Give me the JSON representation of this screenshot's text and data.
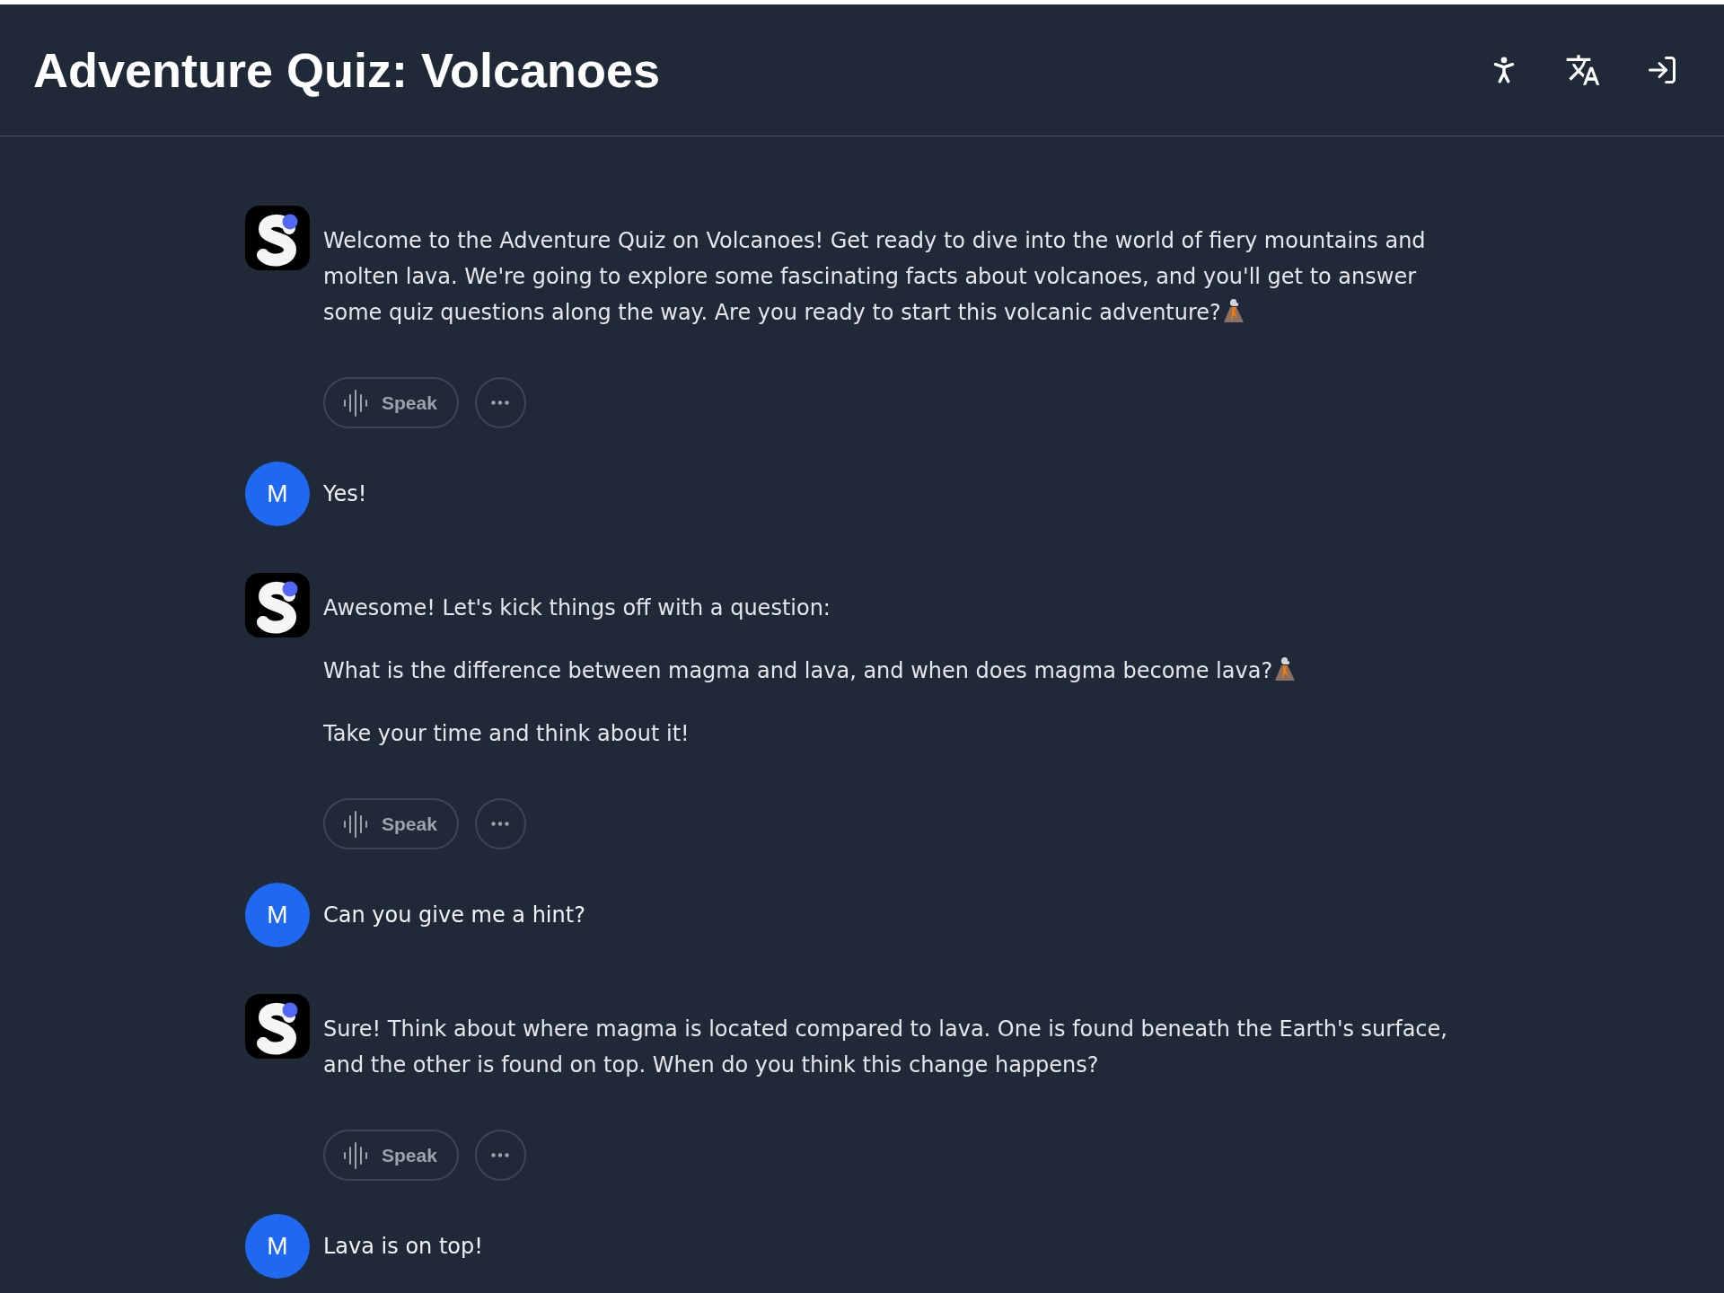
{
  "header": {
    "title": "Adventure Quiz: Volcanoes"
  },
  "messages": [
    {
      "kind": "bot",
      "paragraphs": [
        {
          "text": "Welcome to the Adventure Quiz on Volcanoes! Get ready to dive into the world of fiery mountains and molten lava. We're going to explore some fascinating facts about volcanoes, and you'll get to answer some quiz questions along the way. Are you ready to start this volcanic adventure?",
          "trailing_icon": true
        }
      ],
      "speak_label": "Speak"
    },
    {
      "kind": "user",
      "avatar_initial": "M",
      "text": "Yes!"
    },
    {
      "kind": "bot",
      "paragraphs": [
        {
          "text": "Awesome! Let's kick things off with a question:",
          "trailing_icon": false
        },
        {
          "text": "What is the difference between magma and lava, and when does magma become lava?",
          "trailing_icon": true
        },
        {
          "text": "Take your time and think about it!",
          "trailing_icon": false
        }
      ],
      "speak_label": "Speak"
    },
    {
      "kind": "user",
      "avatar_initial": "M",
      "text": "Can you give me a hint?"
    },
    {
      "kind": "bot",
      "paragraphs": [
        {
          "text": "Sure! Think about where magma is located compared to lava. One is found beneath the Earth's surface, and the other is found on top. When do you think this change happens?",
          "trailing_icon": false
        }
      ],
      "speak_label": "Speak"
    },
    {
      "kind": "user",
      "avatar_initial": "M",
      "text": "Lava is on top!"
    }
  ]
}
